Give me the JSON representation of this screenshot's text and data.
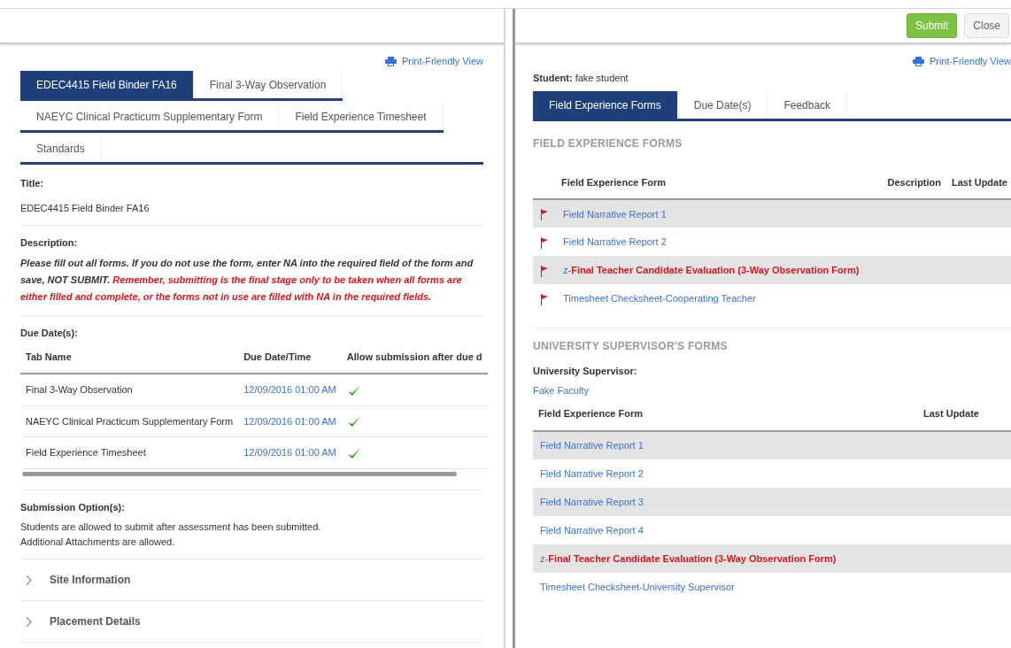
{
  "left": {
    "print_link": "Print-Friendly View",
    "tabs": [
      [
        {
          "label": "EDEC4415 Field Binder FA16",
          "selected": true
        },
        {
          "label": "Final 3-Way Observation",
          "selected": false
        }
      ],
      [
        {
          "label": "NAEYC Clinical Practicum Supplementary Form",
          "selected": false
        },
        {
          "label": "Field Experience Timesheet",
          "selected": false
        }
      ],
      [
        {
          "label": "Standards",
          "selected": false
        }
      ]
    ],
    "title_label": "Title:",
    "title_value": "EDEC4415 Field Binder FA16",
    "description_label": "Description:",
    "description": {
      "text": "Please fill out all forms. If you do not use the form, enter NA into the required field of the form and save, NOT SUBMIT.",
      "warning": "Remember, submitting is the final stage only to be taken when all forms are either filled and complete, or the forms not in use are filled with NA in the required fields."
    },
    "due_dates": {
      "label": "Due Date(s):",
      "columns": [
        "Tab Name",
        "Due Date/Time",
        "Allow submission after due d"
      ],
      "rows": [
        {
          "tab_name": "Final 3-Way Observation",
          "due": "12/09/2016 01:00 AM",
          "allowed": true
        },
        {
          "tab_name": "NAEYC Clinical Practicum Supplementary Form",
          "due": "12/09/2016 01:00 AM",
          "allowed": true
        },
        {
          "tab_name": "Field Experience Timesheet",
          "due": "12/09/2016 01:00 AM",
          "allowed": true
        }
      ]
    },
    "submission_label": "Submission Option(s):",
    "submission_lines": [
      "Students are allowed to submit after assessment has been submitted.",
      "Additional Attachments are allowed."
    ],
    "sections": [
      {
        "label": "Site Information",
        "expanded": false
      },
      {
        "label": "Placement Details",
        "expanded": false
      }
    ]
  },
  "right": {
    "buttons": [
      {
        "label": "Submit",
        "kind": "primary"
      },
      {
        "label": "Close",
        "kind": "secondary"
      }
    ],
    "print_link": "Print-Friendly View",
    "student_label": "Student:",
    "student_name": "fake student",
    "tabs": [
      {
        "label": "Field Experience Forms",
        "selected": true
      },
      {
        "label": "Due Date(s)",
        "selected": false
      },
      {
        "label": "Feedback",
        "selected": false
      }
    ],
    "forms_heading": "FIELD EXPERIENCE FORMS",
    "forms_columns": [
      "Field Experience Form",
      "Description",
      "Last Update"
    ],
    "forms": [
      {
        "text": "Field Narrative Report 1",
        "kind": "normal"
      },
      {
        "text": "Field Narrative Report 2",
        "kind": "normal"
      },
      {
        "prefix": "z-",
        "text": "Final Teacher Candidate Evaluation (3-Way Observation Form)",
        "kind": "final"
      },
      {
        "text": "Timesheet Checksheet-Cooperating Teacher",
        "kind": "normal"
      }
    ],
    "supervisor_heading": "UNIVERSITY SUPERVISOR'S FORMS",
    "supervisor_label": "University Supervisor:",
    "supervisor_name": "Fake Faculty",
    "supervisor_columns": [
      "Field Experience Form",
      "Last Update"
    ],
    "supervisor_forms": [
      {
        "text": "Field Narrative Report 1",
        "kind": "normal"
      },
      {
        "text": "Field Narrative Report 2",
        "kind": "normal"
      },
      {
        "text": "Field Narrative Report 3",
        "kind": "normal"
      },
      {
        "text": "Field Narrative Report 4",
        "kind": "normal"
      },
      {
        "prefix": "z-",
        "text": "Final Teacher Candidate Evaluation (3-Way Observation Form)",
        "kind": "final"
      },
      {
        "text": "Timesheet Checksheet-University Supervisor",
        "kind": "normal"
      }
    ]
  }
}
